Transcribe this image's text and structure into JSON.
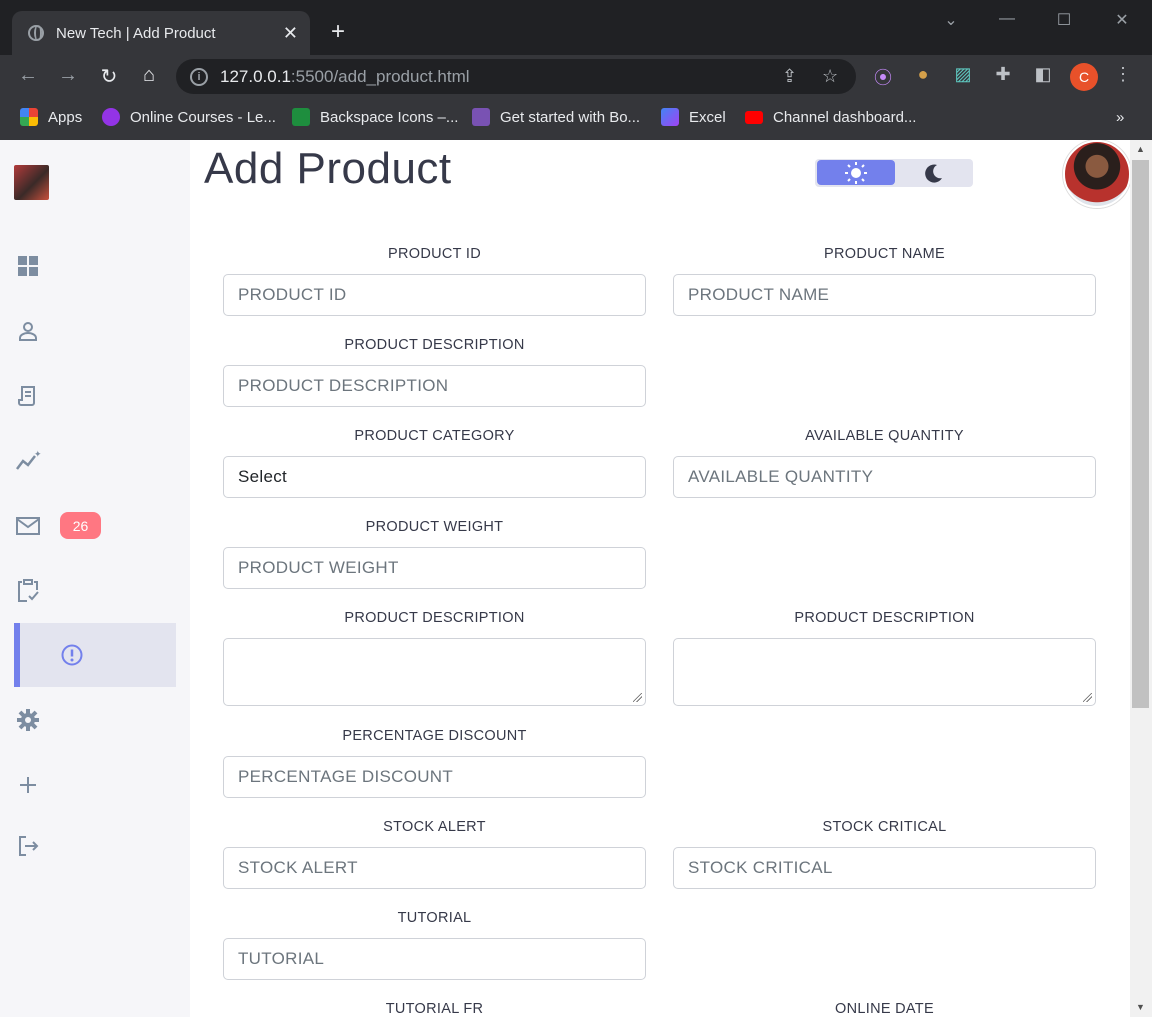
{
  "browser": {
    "tab_title": "New Tech | Add Product",
    "url_host": "127.0.0.1",
    "url_path": ":5500/add_product.html",
    "profile_initial": "C",
    "bookmarks": [
      {
        "label": "Apps",
        "color": "#ea4335"
      },
      {
        "label": "Online Courses - Le...",
        "color": "#9334e6"
      },
      {
        "label": "Backspace Icons –...",
        "color": "#1e8e3e"
      },
      {
        "label": "Get started with Bo...",
        "color": "#7952b3"
      },
      {
        "label": "Excel",
        "color": "#4285f4"
      },
      {
        "label": "Channel dashboard...",
        "color": "#ff0000"
      }
    ],
    "overflow": "»"
  },
  "sidebar": {
    "items": [
      {
        "name": "dashboard",
        "icon": "grid-icon"
      },
      {
        "name": "customers",
        "icon": "person-icon"
      },
      {
        "name": "orders",
        "icon": "receipt-icon"
      },
      {
        "name": "analytics",
        "icon": "insights-icon"
      },
      {
        "name": "messages",
        "icon": "mail-icon",
        "badge": "26"
      },
      {
        "name": "products",
        "icon": "inventory-icon"
      },
      {
        "name": "reports",
        "icon": "report-icon",
        "active": true
      },
      {
        "name": "settings",
        "icon": "gear-icon"
      },
      {
        "name": "add-product",
        "icon": "plus-icon"
      },
      {
        "name": "logout",
        "icon": "logout-icon"
      }
    ]
  },
  "header": {
    "title": "Add Product"
  },
  "colors": {
    "primary": "#7380ec",
    "danger": "#ff7782",
    "text": "#363949"
  },
  "form": {
    "product_id": {
      "label": "PRODUCT ID",
      "placeholder": "PRODUCT ID"
    },
    "product_name": {
      "label": "PRODUCT NAME",
      "placeholder": "PRODUCT NAME"
    },
    "product_description": {
      "label": "PRODUCT DESCRIPTION",
      "placeholder": "PRODUCT DESCRIPTION"
    },
    "product_category": {
      "label": "PRODUCT CATEGORY",
      "value": "Select"
    },
    "available_quantity": {
      "label": "AVAILABLE QUANTITY",
      "placeholder": "AVAILABLE QUANTITY"
    },
    "product_weight": {
      "label": "PRODUCT WEIGHT",
      "placeholder": "PRODUCT WEIGHT"
    },
    "description_left": {
      "label": "PRODUCT DESCRIPTION"
    },
    "description_right": {
      "label": "PRODUCT DESCRIPTION"
    },
    "percentage_discount": {
      "label": "PERCENTAGE DISCOUNT",
      "placeholder": "PERCENTAGE DISCOUNT"
    },
    "stock_alert": {
      "label": "STOCK ALERT",
      "placeholder": "STOCK ALERT"
    },
    "stock_critical": {
      "label": "STOCK CRITICAL",
      "placeholder": "STOCK CRITICAL"
    },
    "tutorial": {
      "label": "TUTORIAL",
      "placeholder": "TUTORIAL"
    },
    "tutorial_fr": {
      "label": "TUTORIAL FR"
    },
    "online_date": {
      "label": "ONLINE DATE"
    }
  }
}
